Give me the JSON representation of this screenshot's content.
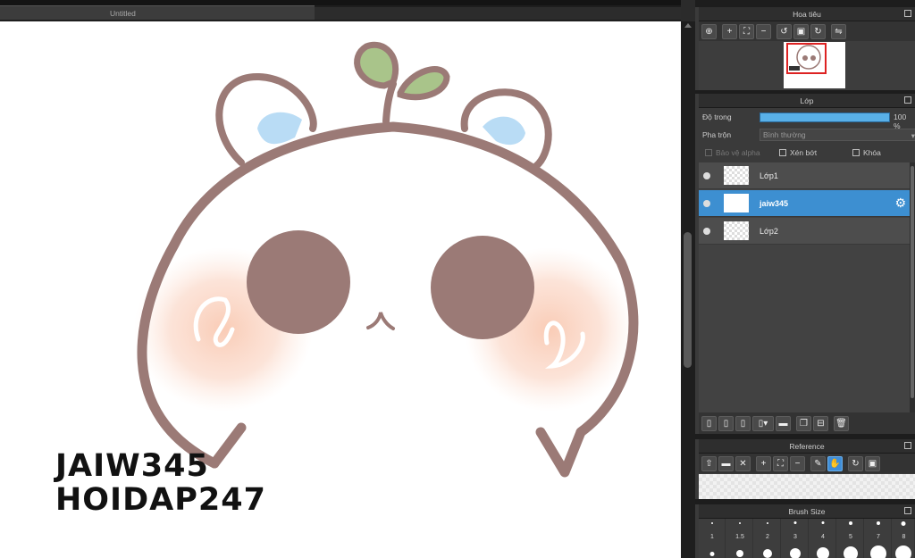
{
  "document": {
    "tab_title": "Untitled"
  },
  "canvas": {
    "watermark_lines": [
      "JAIW345",
      "HOIDAP247"
    ]
  },
  "navigator": {
    "title": "Hoa tiêu",
    "tools": [
      "zoom-fit-icon",
      "zoom-in-icon",
      "fit-window-icon",
      "zoom-out-icon",
      "rotate-left-icon",
      "full-view-icon",
      "rotate-right-icon",
      "flip-icon"
    ]
  },
  "layers": {
    "title": "Lớp",
    "opacity_label": "Độ trong",
    "opacity_value": "100 %",
    "opacity_fraction": 1.0,
    "blend_label": "Pha trộn",
    "blend_value": "Bình thường",
    "protect_alpha_label": "Bảo vệ alpha",
    "clipping_label": "Xén bớt",
    "lock_label": "Khóa",
    "items": [
      {
        "name": "Lớp1",
        "selected": false
      },
      {
        "name": "jaiw345",
        "selected": true
      },
      {
        "name": "Lớp2",
        "selected": false
      }
    ],
    "bottom_tools": [
      "new-layer-icon",
      "new-layer-2-icon",
      "new-layer-3-icon",
      "add-layer-dropdown-icon",
      "folder-icon",
      "duplicate-icon",
      "merge-icon",
      "delete-icon"
    ]
  },
  "reference": {
    "title": "Reference",
    "tools": [
      "upload-icon",
      "open-folder-icon",
      "close-icon",
      "zoom-in-icon",
      "fit-icon",
      "zoom-out-icon",
      "eyedropper-icon",
      "hand-icon",
      "rotate-icon",
      "fullscreen-icon"
    ]
  },
  "brush_size": {
    "title": "Brush Size",
    "sizes": [
      "1",
      "1.5",
      "2",
      "3",
      "4",
      "5",
      "7",
      "8"
    ]
  },
  "colors": {
    "accent": "#3d8fd1",
    "outline": "#9b7a76",
    "leaf": "#a9c48a",
    "ear_inner": "#b9dcf5",
    "blush": "#f9d5c4"
  }
}
